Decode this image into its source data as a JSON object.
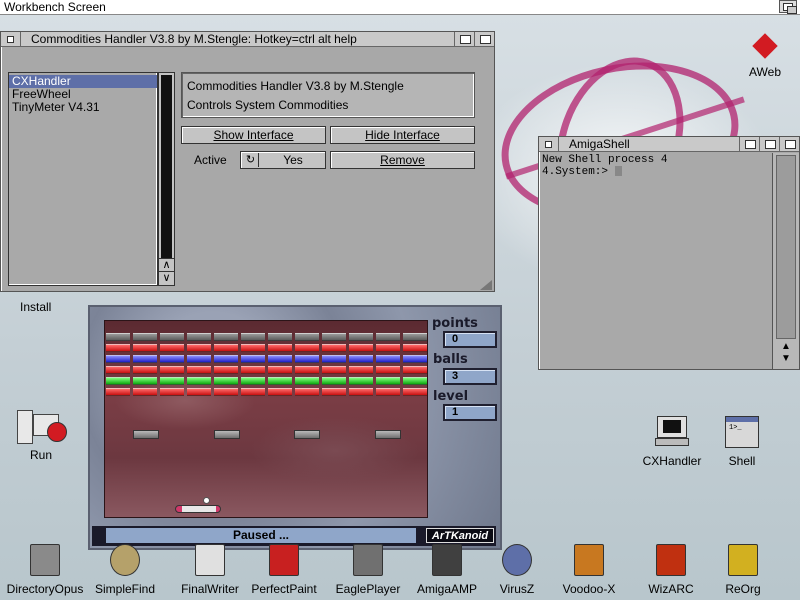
{
  "screen": {
    "title": "Workbench Screen"
  },
  "commodities_window": {
    "title": "Commodities Handler V3.8 by M.Stengle: Hotkey=ctrl alt help",
    "list_items": [
      "CXHandler",
      "FreeWheel",
      "TinyMeter V4.31"
    ],
    "selected_index": 0,
    "info_line1": "Commodities Handler V3.8 by M.Stengle",
    "info_line2": "Controls System Commodities",
    "show_interface": "Show Interface",
    "hide_interface": "Hide Interface",
    "active_label": "Active",
    "active_value": "Yes",
    "remove": "Remove",
    "scroll_up": "∧",
    "scroll_down": "∨"
  },
  "shell_window": {
    "title": "AmigaShell",
    "line1": "New Shell process 4",
    "prompt": "4.System:> "
  },
  "game": {
    "points_label": "points",
    "points_value": "0",
    "balls_label": "balls",
    "balls_value": "3",
    "level_label": "level",
    "level_value": "1",
    "status": "Paused ...",
    "logo": "ArTKanoid"
  },
  "desktop_icons": {
    "aweb": "AWeb",
    "install": "Install",
    "run": "Run",
    "cxhandler": "CXHandler",
    "shell": "Shell"
  },
  "dock": [
    "DirectoryOpus",
    "SimpleFind",
    "FinalWriter",
    "PerfectPaint",
    "EaglePlayer",
    "AmigaAMP",
    "VirusZ",
    "Voodoo-X",
    "WizARC",
    "ReOrg"
  ],
  "colors": {
    "selection": "#5e6fa8",
    "brand_magenta": "#b2226e",
    "game_panel": "#8fa6c9"
  }
}
